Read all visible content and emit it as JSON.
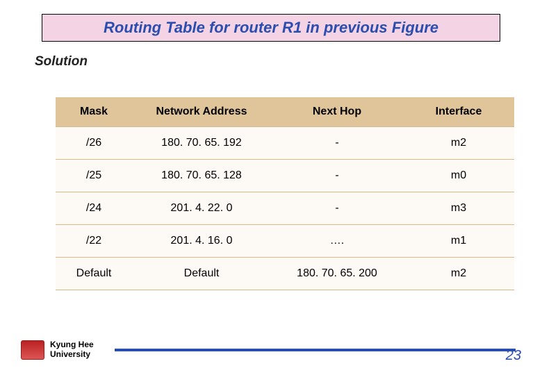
{
  "title": "Routing Table for router R1 in previous Figure",
  "solution_label": "Solution",
  "table": {
    "headers": {
      "c1": "Mask",
      "c2": "Network Address",
      "c3": "Next Hop",
      "c4": "Interface"
    },
    "rows": [
      {
        "mask": "/26",
        "net": "180. 70. 65. 192",
        "hop": "-",
        "iface": "m2"
      },
      {
        "mask": "/25",
        "net": "180. 70. 65. 128",
        "hop": "-",
        "iface": "m0"
      },
      {
        "mask": "/24",
        "net": "201. 4. 22. 0",
        "hop": "-",
        "iface": "m3"
      },
      {
        "mask": "/22",
        "net": "201. 4. 16. 0",
        "hop": "….",
        "iface": "m1"
      },
      {
        "mask": "Default",
        "net": "Default",
        "hop": "180. 70. 65. 200",
        "iface": "m2"
      }
    ]
  },
  "footer": {
    "uni_line1": "Kyung Hee",
    "uni_line2": "University",
    "page": "23"
  }
}
